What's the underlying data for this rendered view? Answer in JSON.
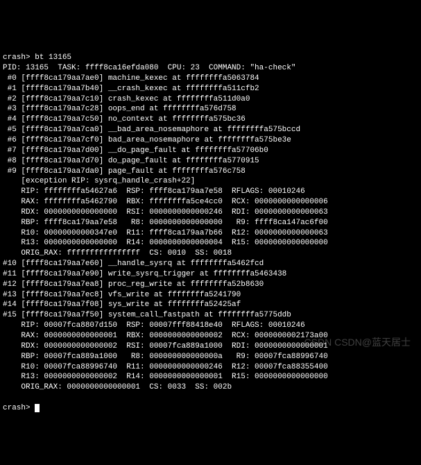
{
  "terminal": {
    "top_partial": "                                                                   ",
    "cmd_line": "crash> bt 13165",
    "header": "PID: 13165  TASK: ffff8ca16efda080  CPU: 23  COMMAND: \"ha-check\"",
    "frames_a": [
      " #0 [ffff8ca179aa7ae0] machine_kexec at ffffffffa5063784",
      " #1 [ffff8ca179aa7b40] __crash_kexec at ffffffffa511cfb2",
      " #2 [ffff8ca179aa7c10] crash_kexec at ffffffffa511d0a0",
      " #3 [ffff8ca179aa7c28] oops_end at ffffffffa576d758",
      " #4 [ffff8ca179aa7c50] no_context at ffffffffa575bc36",
      " #5 [ffff8ca179aa7ca0] __bad_area_nosemaphore at ffffffffa575bccd",
      " #6 [ffff8ca179aa7cf0] bad_area_nosemaphore at ffffffffa575be3e",
      " #7 [ffff8ca179aa7d00] __do_page_fault at ffffffffa57706b0",
      " #8 [ffff8ca179aa7d70] do_page_fault at ffffffffa5770915",
      " #9 [ffff8ca179aa7da0] page_fault at ffffffffa576c758"
    ],
    "exception": "    [exception RIP: sysrq_handle_crash+22]",
    "regs_a": [
      "    RIP: ffffffffa54627a6  RSP: ffff8ca179aa7e58  RFLAGS: 00010246",
      "    RAX: ffffffffa5462790  RBX: ffffffffa5ce4cc0  RCX: 0000000000000006",
      "    RDX: 0000000000000000  RSI: 0000000000000246  RDI: 0000000000000063",
      "    RBP: ffff8ca179aa7e58   R8: 0000000000000000   R9: ffff8ca147ac6f00",
      "    R10: 00000000000347e0  R11: ffff8ca179aa7b66  R12: 0000000000000063",
      "    R13: 0000000000000000  R14: 0000000000000004  R15: 0000000000000000",
      "    ORIG_RAX: ffffffffffffffff  CS: 0010  SS: 0018"
    ],
    "frames_b": [
      "#10 [ffff8ca179aa7e60] __handle_sysrq at ffffffffa5462fcd",
      "#11 [ffff8ca179aa7e90] write_sysrq_trigger at ffffffffa5463438",
      "#12 [ffff8ca179aa7ea8] proc_reg_write at ffffffffa52b8630",
      "#13 [ffff8ca179aa7ec8] vfs_write at ffffffffa5241790",
      "#14 [ffff8ca179aa7f08] sys_write at ffffffffa52425af",
      "#15 [ffff8ca179aa7f50] system_call_fastpath at ffffffffa5775ddb"
    ],
    "regs_b": [
      "    RIP: 00007fca8807d150  RSP: 00007fff88418e40  RFLAGS: 00010246",
      "    RAX: 0000000000000001  RBX: 0000000000000002  RCX: 0000000002173a00",
      "    RDX: 0000000000000002  RSI: 00007fca889a1000  RDI: 0000000000000001",
      "    RBP: 00007fca889a1000   R8: 000000000000000a   R9: 00007fca88996740",
      "    R10: 00007fca88996740  R11: 0000000000000246  R12: 00007fca88355400",
      "    R13: 0000000000000002  R14: 0000000000000001  R15: 0000000000000000",
      "    ORIG_RAX: 0000000000000001  CS: 0033  SS: 002b"
    ],
    "prompt": "crash> "
  },
  "watermark": "CSDN CSDN@蓝天居士"
}
